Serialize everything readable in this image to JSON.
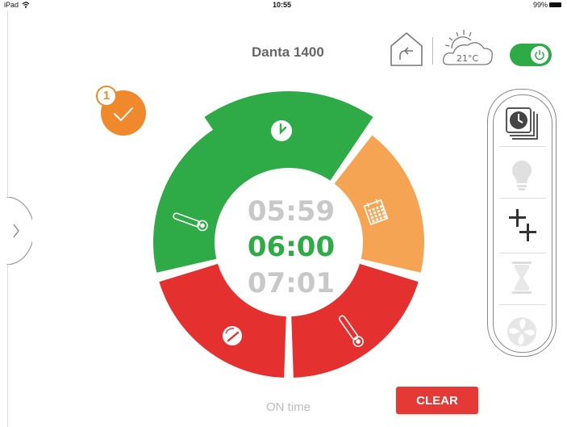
{
  "status_bar": {
    "device": "iPad",
    "time": "10:55",
    "battery": "99%"
  },
  "header": {
    "title": "Danta 1400",
    "temperature": "21°C",
    "power_state": "on"
  },
  "badge": {
    "count": "1"
  },
  "wheel": {
    "segments": [
      {
        "name": "timer",
        "color": "#2eaa47",
        "icon": "clock-icon"
      },
      {
        "name": "calendar",
        "color": "#f5a453",
        "icon": "calendar-icon"
      },
      {
        "name": "thermometer-right",
        "color": "#e53030",
        "icon": "thermometer-icon"
      },
      {
        "name": "gauge",
        "color": "#e53030",
        "icon": "gauge-icon"
      },
      {
        "name": "thermometer-left",
        "color": "#2eaa47",
        "icon": "thermometer-icon"
      }
    ],
    "time_prev": "05:59",
    "time_current": "06:00",
    "time_next": "07:01"
  },
  "side_panel": {
    "items": [
      {
        "icon": "clock-stack-icon",
        "active": true
      },
      {
        "icon": "bulb-icon",
        "active": false
      },
      {
        "icon": "plus-plus-icon",
        "active": true
      },
      {
        "icon": "hourglass-icon",
        "active": false
      },
      {
        "icon": "fan-icon",
        "active": false
      }
    ]
  },
  "footer": {
    "on_time_label": "ON time",
    "clear_label": "CLEAR"
  },
  "colors": {
    "green": "#2eaa47",
    "orange": "#f5a453",
    "red": "#e53030",
    "badge_orange": "#f0892b",
    "time_gray": "#c8c8c8"
  }
}
